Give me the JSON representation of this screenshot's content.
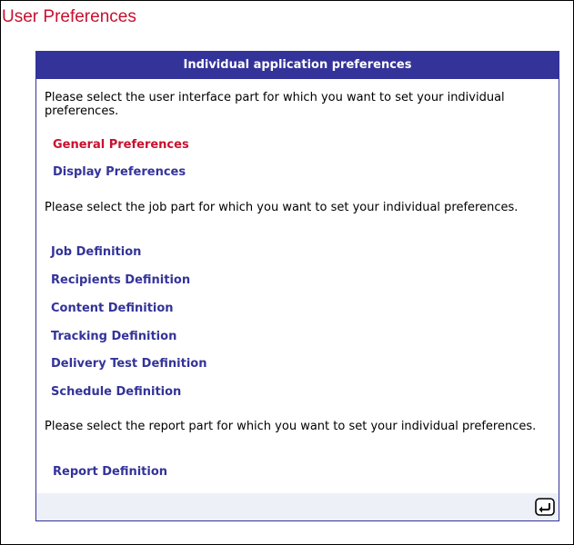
{
  "page": {
    "title": "User Preferences"
  },
  "panel": {
    "header": "Individual application preferences",
    "sections": [
      {
        "intro": "Please select the user interface part for which you want to set your individual preferences.",
        "links": [
          {
            "label": "General Preferences",
            "active": true
          },
          {
            "label": "Display Preferences",
            "active": false
          }
        ]
      },
      {
        "intro": "Please select the job part for which you want to set your individual preferences.",
        "links": [
          {
            "label": "Job Definition"
          },
          {
            "label": "Recipients Definition"
          },
          {
            "label": "Content Definition"
          },
          {
            "label": "Tracking Definition"
          },
          {
            "label": "Delivery Test Definition"
          },
          {
            "label": "Schedule Definition"
          }
        ]
      },
      {
        "intro": "Please select the report part for which you want to set your individual preferences.",
        "links": [
          {
            "label": "Report Definition"
          }
        ]
      }
    ],
    "footer": {
      "back_icon": "return-arrow-icon"
    }
  },
  "colors": {
    "accent": "#33339a",
    "title_red": "#c8102e",
    "footer_bg": "#eef0f8"
  }
}
